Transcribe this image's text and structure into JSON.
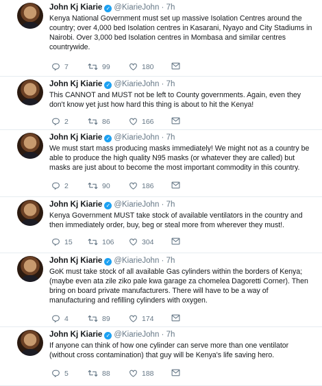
{
  "tweets": [
    {
      "name": "John Kj Kiarie",
      "handle": "@KiarieJohn",
      "time": "7h",
      "lines": [
        "Kenya National Government must set up massive Isolation Centres around the",
        "country; over 4,000 bed Isolation centres in Kasarani, Nyayo and City Stadiums in",
        "Nairobi. Over 3,000 bed Isolation centres in Mombasa and similar centres",
        "countrywide."
      ],
      "replies": "7",
      "retweets": "99",
      "likes": "180"
    },
    {
      "name": "John Kj Kiarie",
      "handle": "@KiarieJohn",
      "time": "7h",
      "lines": [
        "This CANNOT and MUST not be left to County governments. Again, even they",
        "don't know yet just how hard this thing is about to hit the Kenya!"
      ],
      "replies": "2",
      "retweets": "86",
      "likes": "166"
    },
    {
      "name": "John Kj Kiarie",
      "handle": "@KiarieJohn",
      "time": "7h",
      "lines": [
        "We must start mass producing masks immediately! We might not as a country be",
        "able to produce the high quality N95 masks (or whatever they are called) but",
        "masks are just about to become the most important commodity in this country."
      ],
      "replies": "2",
      "retweets": "90",
      "likes": "186"
    },
    {
      "name": "John Kj Kiarie",
      "handle": "@KiarieJohn",
      "time": "7h",
      "lines": [
        "Kenya Government MUST take stock of available ventilators in the country and",
        "then immediately order, buy, beg or steal more from wherever they must!."
      ],
      "replies": "15",
      "retweets": "106",
      "likes": "304"
    },
    {
      "name": "John Kj Kiarie",
      "handle": "@KiarieJohn",
      "time": "7h",
      "lines": [
        "GoK must take stock of all available Gas cylinders within the borders of Kenya;",
        "(maybe even ata zile ziko pale kwa garage za chomelea Dagoretti Corner). Then",
        "bring on board private manufacturers. There will have to be a way of",
        "manufacturing and refilling cylinders with oxygen."
      ],
      "replies": "4",
      "retweets": "89",
      "likes": "174"
    },
    {
      "name": "John Kj Kiarie",
      "handle": "@KiarieJohn",
      "time": "7h",
      "lines": [
        "If anyone can think of how one cylinder can serve more than one ventilator",
        "(without cross contamination) that guy will be Kenya's life saving hero."
      ],
      "replies": "5",
      "retweets": "88",
      "likes": "188"
    }
  ],
  "icons": {
    "reply": "reply-icon",
    "retweet": "retweet-icon",
    "like": "heart-icon",
    "message": "envelope-icon"
  },
  "colors": {
    "verified": "#1da1f2",
    "meta": "#657786",
    "text": "#14171a"
  }
}
